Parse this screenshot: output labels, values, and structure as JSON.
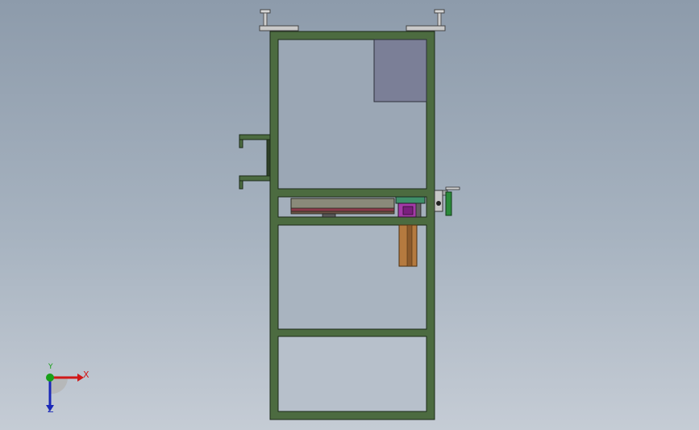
{
  "viewport": {
    "background_top": "#8d9bab",
    "background_bottom": "#c5ccd5"
  },
  "model": {
    "frame_color": "#4c6b40",
    "frame_edge": "#1b2a18",
    "panel_color": "#7b7f97",
    "conveyor_color": "#6a5244",
    "slider_color": "#a43aa8",
    "post_color": "#b57a3f",
    "handle_color": "#2b8a3a"
  },
  "triad": {
    "x_label": "X",
    "y_label": "Y",
    "z_label": "Z",
    "x_color": "#d01818",
    "y_color": "#18a018",
    "z_color": "#1a28b8"
  }
}
